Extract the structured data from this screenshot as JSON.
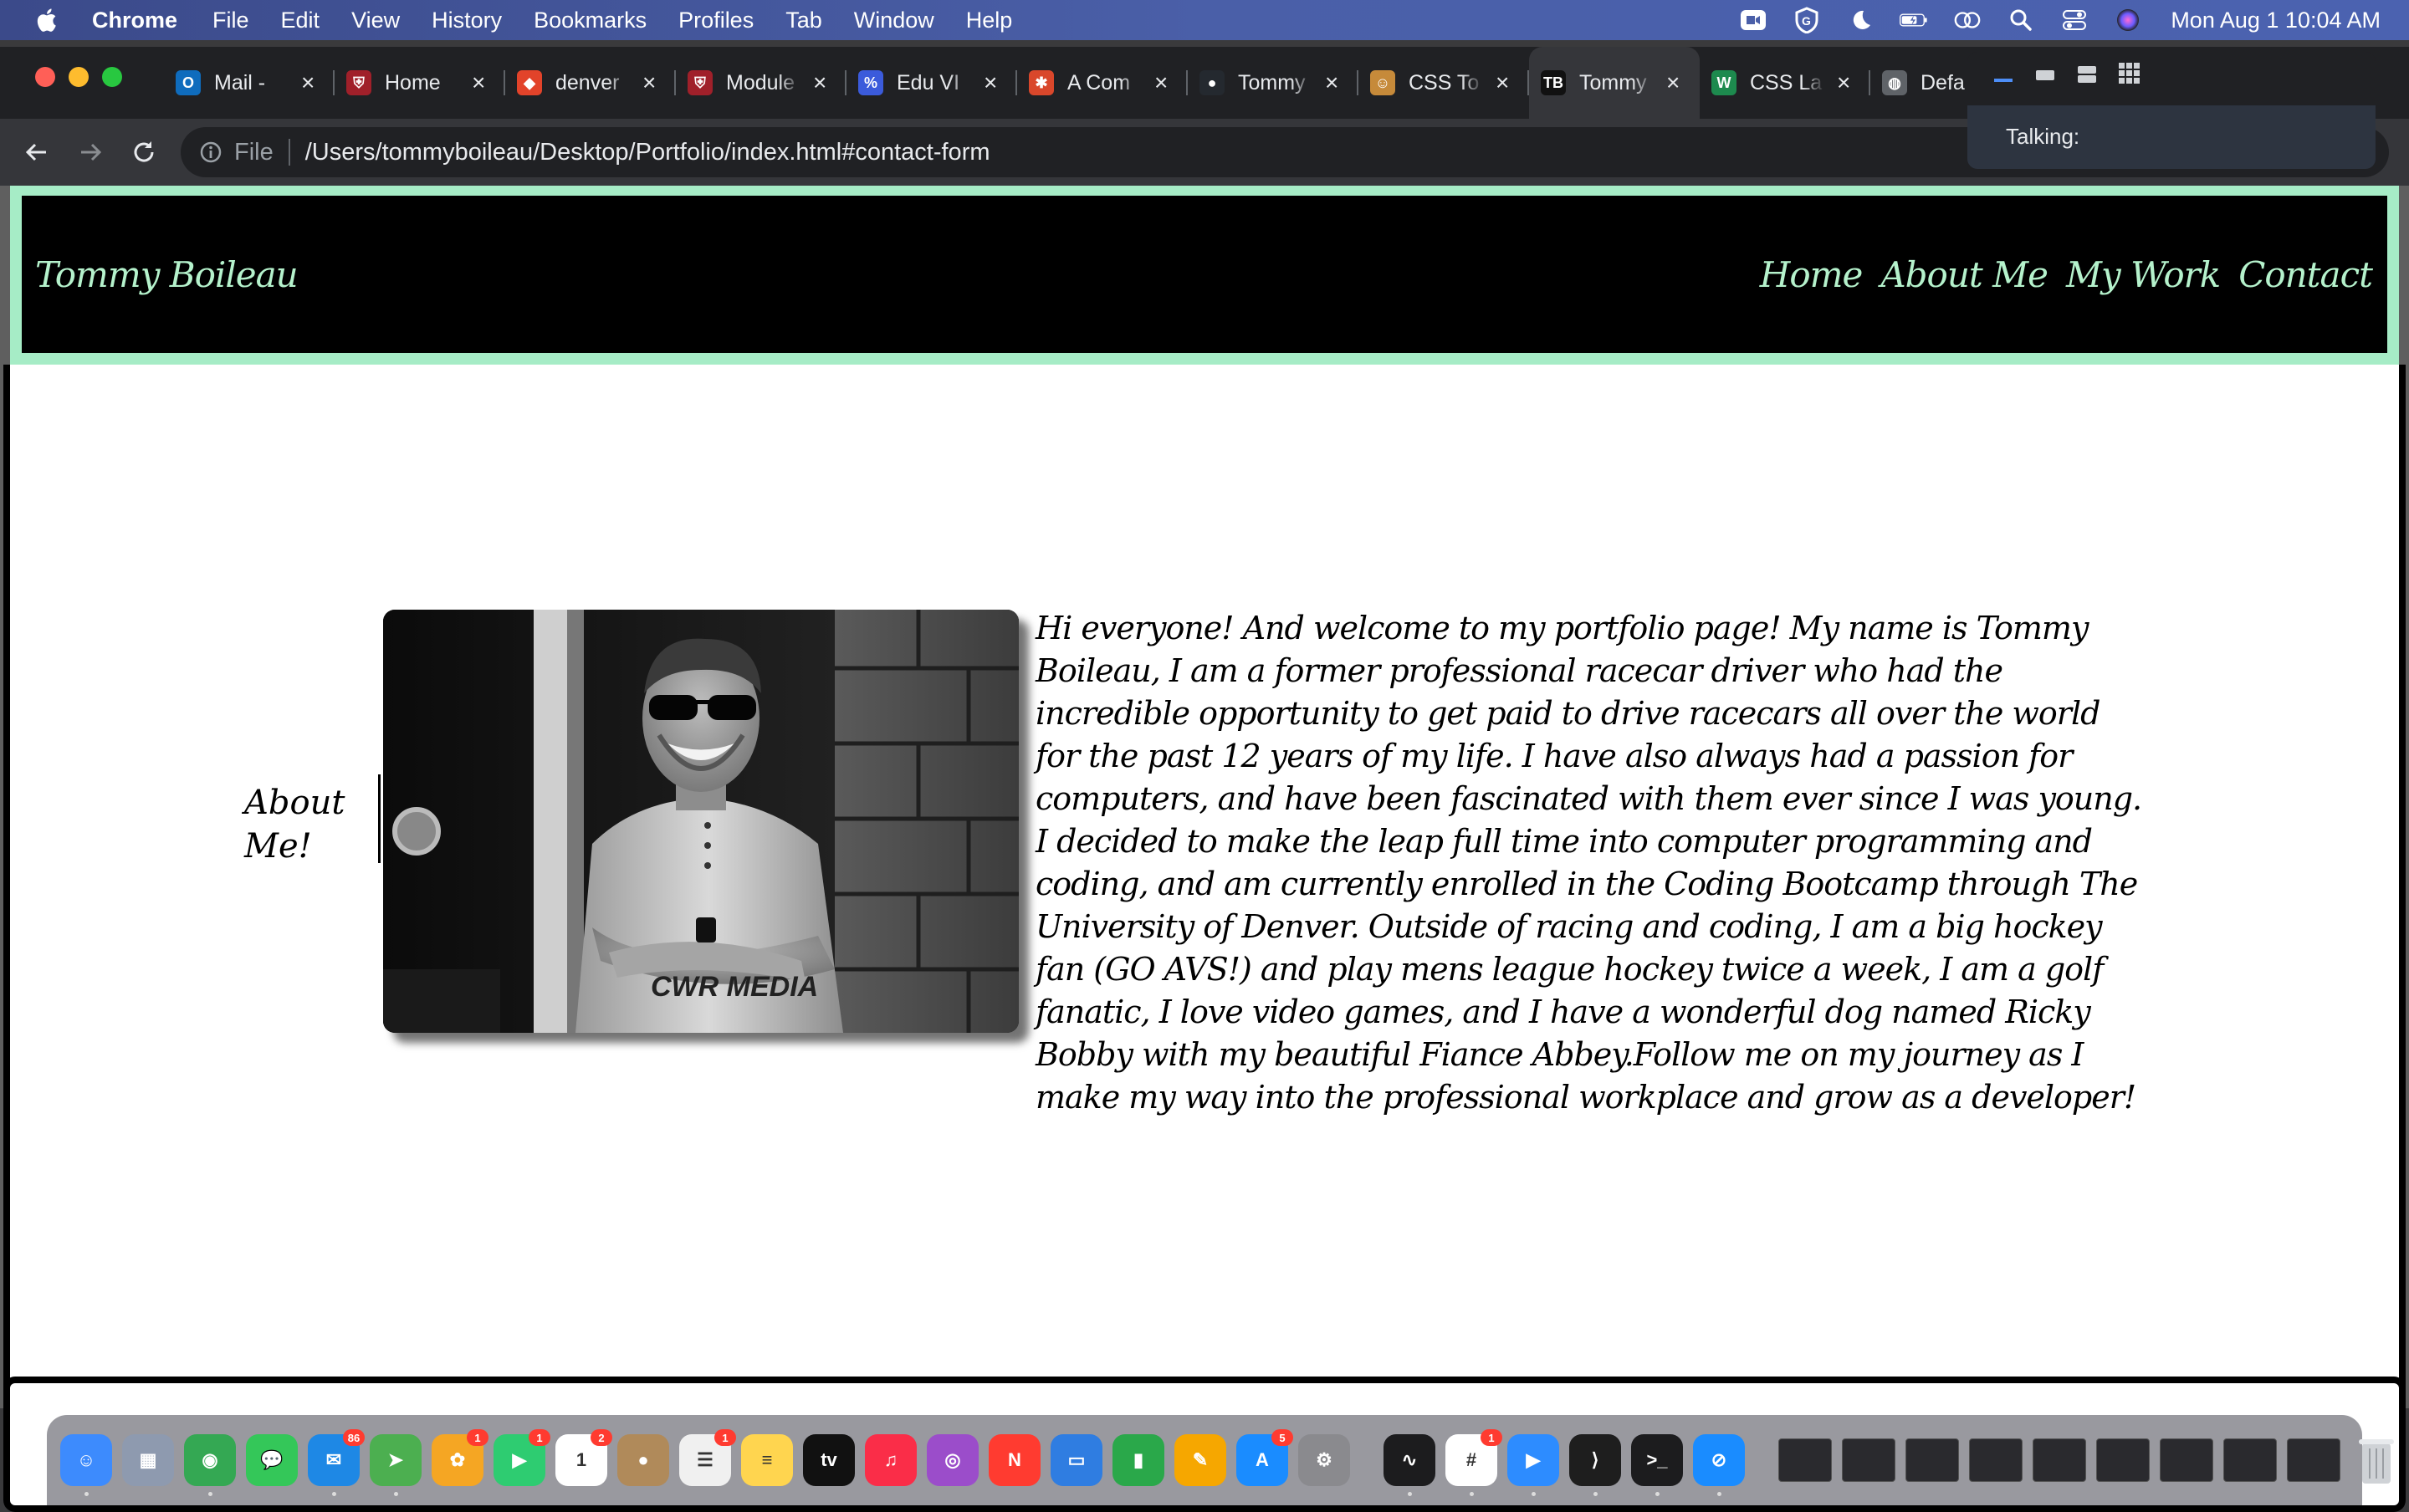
{
  "menubar": {
    "app": "Chrome",
    "items": [
      "File",
      "Edit",
      "View",
      "History",
      "Bookmarks",
      "Profiles",
      "Tab",
      "Window",
      "Help"
    ],
    "clock": "Mon Aug 1  10:04 AM"
  },
  "tabs": [
    {
      "title": "Mail -",
      "color": "#0f6cbd",
      "glyph": "O"
    },
    {
      "title": "Home",
      "color": "#a0202a",
      "glyph": "⛨"
    },
    {
      "title": "denver",
      "color": "#e2432a",
      "glyph": "◆"
    },
    {
      "title": "Module",
      "color": "#a0202a",
      "glyph": "⛨"
    },
    {
      "title": "Edu VI",
      "color": "#3b5bdb",
      "glyph": "%"
    },
    {
      "title": "A Com",
      "color": "#d9472b",
      "glyph": "✱"
    },
    {
      "title": "Tommy",
      "color": "#24292f",
      "glyph": "●"
    },
    {
      "title": "CSS To",
      "color": "#c68a3a",
      "glyph": "☺"
    },
    {
      "title": "Tommy",
      "color": "#111111",
      "glyph": "TB",
      "active": true
    },
    {
      "title": "CSS La",
      "color": "#1d8a4e",
      "glyph": "W"
    },
    {
      "title": "Defa",
      "color": "#5f6368",
      "glyph": "◍"
    }
  ],
  "omnibox": {
    "scheme": "File",
    "url": "/Users/tommyboileau/Desktop/Portfolio/index.html#contact-form"
  },
  "talk_panel": {
    "label": "Talking:"
  },
  "site": {
    "title": "Tommy Boileau",
    "nav": [
      "Home",
      "About Me",
      "My Work",
      "Contact"
    ],
    "about_heading": "About Me!",
    "about_text": "Hi everyone! And welcome to my portfolio page! My name is Tommy Boileau, I am a former professional racecar driver who had the incredible opportunity to get paid to drive racecars all over the world for the past 12 years of my life. I have also always had a passion for computers, and have been fascinated with them ever since I was young. I decided to make the leap full time into computer programming and coding, and am currently enrolled in the Coding Bootcamp through The University of Denver. Outside of racing and coding, I am a big hockey fan (GO AVS!) and play mens league hockey twice a week, I am a golf fanatic, I love video games, and I have a wonderful dog named Ricky Bobby with my beautiful Fiance Abbey.Follow me on my journey as I make my way into the professional workplace and grow as a developer!",
    "photo_watermark": "CWR MEDIA",
    "accent_color": "#b5f2cc"
  },
  "dock": {
    "apps": [
      {
        "name": "finder",
        "color": "#3d8bfd",
        "glyph": "☺",
        "dot": true
      },
      {
        "name": "launchpad",
        "color": "#8e9aaf",
        "glyph": "▦"
      },
      {
        "name": "chrome",
        "color": "#34a853",
        "glyph": "◉",
        "dot": true
      },
      {
        "name": "messages",
        "color": "#34c759",
        "glyph": "💬"
      },
      {
        "name": "mail",
        "color": "#1e88e5",
        "glyph": "✉",
        "badge": "86",
        "dot": true
      },
      {
        "name": "maps",
        "color": "#4caf50",
        "glyph": "➤",
        "dot": true
      },
      {
        "name": "photos",
        "color": "#f5a623",
        "glyph": "✿",
        "badge": "1"
      },
      {
        "name": "facetime",
        "color": "#2ecc71",
        "glyph": "▶",
        "badge": "1"
      },
      {
        "name": "calendar",
        "color": "#ffffff",
        "glyph": "1",
        "badge": "2"
      },
      {
        "name": "contacts",
        "color": "#b08a5a",
        "glyph": "●"
      },
      {
        "name": "reminders",
        "color": "#f0f0f0",
        "glyph": "☰",
        "badge": "1"
      },
      {
        "name": "notes",
        "color": "#ffd54f",
        "glyph": "≡"
      },
      {
        "name": "apple-tv",
        "color": "#111111",
        "glyph": "tv"
      },
      {
        "name": "music",
        "color": "#fa2d48",
        "glyph": "♫"
      },
      {
        "name": "podcasts",
        "color": "#9b4dca",
        "glyph": "◎"
      },
      {
        "name": "news",
        "color": "#ff3b30",
        "glyph": "N"
      },
      {
        "name": "keynote",
        "color": "#2f7de1",
        "glyph": "▭"
      },
      {
        "name": "numbers",
        "color": "#2aa84a",
        "glyph": "▮"
      },
      {
        "name": "pages",
        "color": "#f6a700",
        "glyph": "✎"
      },
      {
        "name": "app-store",
        "color": "#1a8cff",
        "glyph": "A",
        "badge": "5"
      },
      {
        "name": "system-preferences",
        "color": "#8a8a8e",
        "glyph": "⚙"
      },
      {
        "name": "activity-monitor",
        "color": "#1c1c1e",
        "glyph": "∿",
        "dot": true
      },
      {
        "name": "slack",
        "color": "#ffffff",
        "glyph": "#",
        "badge": "1",
        "dot": true
      },
      {
        "name": "zoom",
        "color": "#2d8cff",
        "glyph": "▶",
        "dot": true
      },
      {
        "name": "vscode",
        "color": "#1e1e1e",
        "glyph": "⟩",
        "dot": true
      },
      {
        "name": "terminal",
        "color": "#1c1c1e",
        "glyph": ">_",
        "dot": true
      },
      {
        "name": "safari",
        "color": "#1a8cff",
        "glyph": "⊘",
        "dot": true
      }
    ]
  }
}
